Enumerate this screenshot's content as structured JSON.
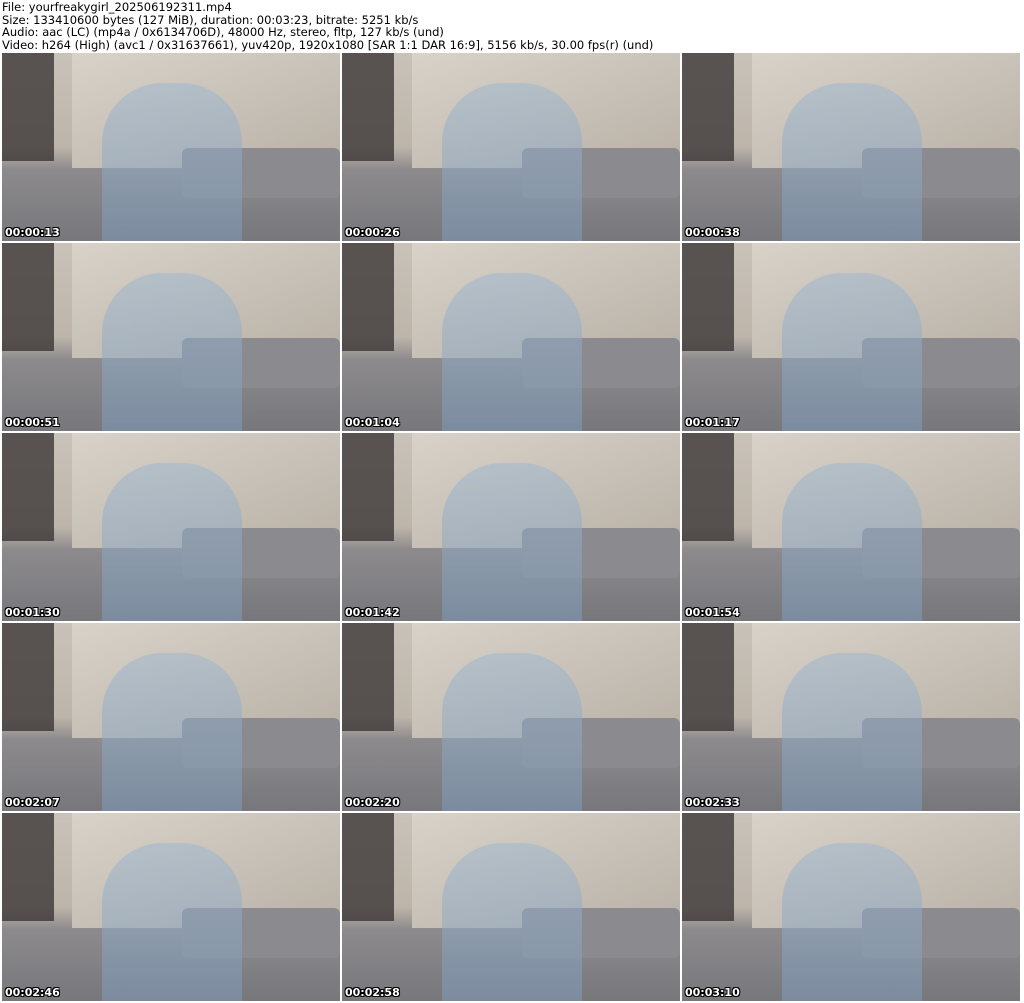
{
  "info": {
    "file": "File: yourfreakygirl_202506192311.mp4",
    "size": "Size: 133410600 bytes (127 MiB), duration: 00:03:23, bitrate: 5251 kb/s",
    "audio": "Audio: aac (LC) (mp4a / 0x6134706D), 48000 Hz, stereo, fltp, 127 kb/s (und)",
    "video": "Video: h264 (High) (avc1 / 0x31637661), yuv420p, 1920x1080 [SAR 1:1 DAR 16:9], 5156 kb/s, 30.00 fps(r) (und)"
  },
  "frames": [
    "00:00:13",
    "00:00:26",
    "00:00:38",
    "00:00:51",
    "00:01:04",
    "00:01:17",
    "00:01:30",
    "00:01:42",
    "00:01:54",
    "00:02:07",
    "00:02:20",
    "00:02:33",
    "00:02:46",
    "00:02:58",
    "00:03:10"
  ]
}
